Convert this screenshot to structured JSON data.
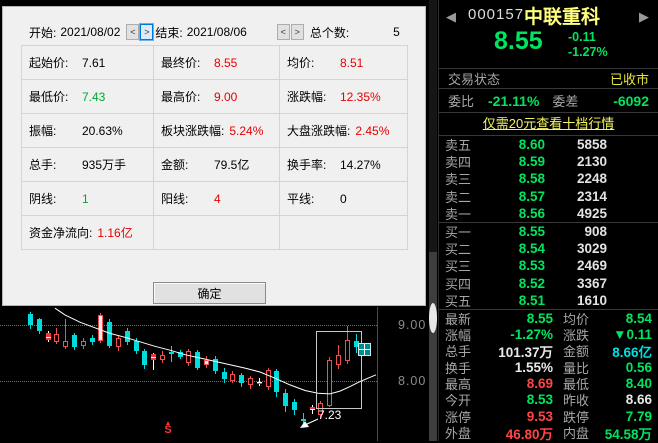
{
  "dialog": {
    "start_label": "开始:",
    "start_value": "2021/08/02",
    "end_label": "结束:",
    "end_value": "2021/08/06",
    "count_label": "总个数:",
    "count_value": "5",
    "spin_prev": "<",
    "spin_next": ">",
    "ok_label": "确定",
    "cells": [
      {
        "label": "起始价:",
        "value": "7.61",
        "color": "black"
      },
      {
        "label": "最终价:",
        "value": "8.55",
        "color": "red"
      },
      {
        "label": "均价:",
        "value": "8.51",
        "color": "red"
      },
      {
        "label": "最低价:",
        "value": "7.43",
        "color": "green"
      },
      {
        "label": "最高价:",
        "value": "9.00",
        "color": "red"
      },
      {
        "label": "涨跌幅:",
        "value": "12.35%",
        "color": "red"
      },
      {
        "label": "振幅:",
        "value": "20.63%",
        "color": "black"
      },
      {
        "label": "板块涨跌幅:",
        "value": "5.24%",
        "color": "red"
      },
      {
        "label": "大盘涨跌幅:",
        "value": "2.45%",
        "color": "red"
      },
      {
        "label": "总手:",
        "value": "935万手",
        "color": "black"
      },
      {
        "label": "金额:",
        "value": "79.5亿",
        "color": "black"
      },
      {
        "label": "换手率:",
        "value": "14.27%",
        "color": "black"
      },
      {
        "label": "阴线:",
        "value": "1",
        "color": "green"
      },
      {
        "label": "阳线:",
        "value": "4",
        "color": "red"
      },
      {
        "label": "平线:",
        "value": "0",
        "color": "black"
      },
      {
        "label": "资金净流向:",
        "value": "1.16亿",
        "color": "red"
      },
      {
        "label": "",
        "value": "",
        "color": "black"
      },
      {
        "label": "",
        "value": "",
        "color": "black"
      }
    ]
  },
  "chart_data": {
    "type": "candlestick",
    "title": "",
    "ylabels": [
      "9.00",
      "8.00"
    ],
    "grid_prices": [
      9.0,
      8.0
    ],
    "ylim": [
      7.0,
      9.32
    ],
    "annotation_low": "7.23",
    "signal_label": "S",
    "candles": [
      [
        9.2,
        9.24,
        8.93,
        9.0,
        ""
      ],
      [
        9.1,
        9.13,
        8.84,
        8.9,
        ""
      ],
      [
        8.74,
        8.9,
        8.7,
        8.86,
        "m"
      ],
      [
        8.7,
        8.94,
        8.66,
        8.84,
        ""
      ],
      [
        8.61,
        9.1,
        8.57,
        8.71,
        ""
      ],
      [
        8.82,
        8.86,
        8.56,
        8.6,
        ""
      ],
      [
        8.62,
        8.77,
        8.58,
        8.71,
        ""
      ],
      [
        8.76,
        8.82,
        8.64,
        8.7,
        ""
      ],
      [
        8.72,
        9.22,
        8.68,
        9.18,
        "w"
      ],
      [
        9.06,
        9.1,
        8.58,
        8.63,
        ""
      ],
      [
        8.6,
        8.83,
        8.55,
        8.77,
        ""
      ],
      [
        8.9,
        8.94,
        8.64,
        8.7,
        ""
      ],
      [
        8.71,
        8.76,
        8.48,
        8.54,
        ""
      ],
      [
        8.54,
        8.58,
        8.22,
        8.28,
        ""
      ],
      [
        8.38,
        8.5,
        8.2,
        8.48,
        "m"
      ],
      [
        8.37,
        8.53,
        8.31,
        8.47,
        ""
      ],
      [
        8.52,
        8.62,
        8.34,
        8.49,
        ""
      ],
      [
        8.51,
        8.55,
        8.39,
        8.43,
        ""
      ],
      [
        8.33,
        8.58,
        8.28,
        8.53,
        ""
      ],
      [
        8.51,
        8.55,
        8.19,
        8.24,
        ""
      ],
      [
        8.28,
        8.44,
        8.23,
        8.38,
        "w"
      ],
      [
        8.4,
        8.45,
        8.12,
        8.18,
        ""
      ],
      [
        8.16,
        8.24,
        7.98,
        8.04,
        ""
      ],
      [
        8.0,
        8.17,
        7.95,
        8.12,
        ""
      ],
      [
        8.1,
        8.15,
        7.9,
        7.97,
        ""
      ],
      [
        7.92,
        8.09,
        7.86,
        8.05,
        ""
      ],
      [
        7.99,
        8.06,
        7.92,
        7.98,
        "m"
      ],
      [
        7.9,
        8.24,
        7.85,
        8.2,
        ""
      ],
      [
        8.18,
        8.22,
        7.72,
        7.8,
        ""
      ],
      [
        7.78,
        7.86,
        7.45,
        7.55,
        ""
      ],
      [
        7.62,
        7.68,
        7.4,
        7.48,
        ""
      ],
      [
        7.32,
        7.42,
        7.23,
        7.3,
        ""
      ],
      [
        7.48,
        7.58,
        7.42,
        7.54,
        "m"
      ],
      [
        7.4,
        7.64,
        7.34,
        7.6,
        ""
      ],
      [
        7.55,
        8.42,
        7.52,
        8.38,
        ""
      ],
      [
        8.28,
        8.64,
        8.22,
        8.46,
        ""
      ],
      [
        8.36,
        8.98,
        8.3,
        8.74,
        ""
      ],
      [
        8.72,
        8.84,
        8.5,
        8.6,
        ""
      ],
      [
        8.62,
        8.68,
        8.44,
        8.55,
        ""
      ]
    ],
    "ma": [
      [
        55,
        9.3
      ],
      [
        65,
        9.18
      ],
      [
        80,
        9.05
      ],
      [
        95,
        8.95
      ],
      [
        110,
        8.85
      ],
      [
        125,
        8.78
      ],
      [
        140,
        8.7
      ],
      [
        155,
        8.62
      ],
      [
        170,
        8.55
      ],
      [
        185,
        8.47
      ],
      [
        200,
        8.41
      ],
      [
        215,
        8.35
      ],
      [
        230,
        8.29
      ],
      [
        245,
        8.23
      ],
      [
        260,
        8.16
      ],
      [
        275,
        8.05
      ],
      [
        290,
        7.93
      ],
      [
        305,
        7.83
      ],
      [
        318,
        7.78
      ],
      [
        330,
        7.77
      ],
      [
        340,
        7.82
      ],
      [
        350,
        7.9
      ],
      [
        360,
        7.99
      ],
      [
        368,
        8.05
      ],
      [
        376,
        8.11
      ]
    ]
  },
  "panel": {
    "nav_prev": "◀",
    "nav_next": "▶",
    "code": "000157",
    "name": "中联重科",
    "price": "8.55",
    "change": "-0.11",
    "change_pct": "-1.27%",
    "status_label": "交易状态",
    "status_value": "已收市",
    "weibi_label": "委比",
    "weibi_value": "-21.11%",
    "weicha_label": "委差",
    "weicha_value": "-6092",
    "link_text": "仅需20元查看十档行情",
    "asks": [
      {
        "label": "卖五",
        "price": "8.60",
        "vol": "5858"
      },
      {
        "label": "卖四",
        "price": "8.59",
        "vol": "2130"
      },
      {
        "label": "卖三",
        "price": "8.58",
        "vol": "2248"
      },
      {
        "label": "卖二",
        "price": "8.57",
        "vol": "2314"
      },
      {
        "label": "卖一",
        "price": "8.56",
        "vol": "4925"
      }
    ],
    "bids": [
      {
        "label": "买一",
        "price": "8.55",
        "vol": "908"
      },
      {
        "label": "买二",
        "price": "8.54",
        "vol": "3029"
      },
      {
        "label": "买三",
        "price": "8.53",
        "vol": "2469"
      },
      {
        "label": "买四",
        "price": "8.52",
        "vol": "3367"
      },
      {
        "label": "买五",
        "price": "8.51",
        "vol": "1610"
      }
    ],
    "stats": [
      {
        "l1": "最新",
        "v1": "8.55",
        "c1": "green",
        "l2": "均价",
        "v2": "8.54",
        "c2": "green"
      },
      {
        "l1": "涨幅",
        "v1": "-1.27%",
        "c1": "green",
        "l2": "涨跌",
        "v2": "▼0.11",
        "c2": "green"
      },
      {
        "l1": "总手",
        "v1": "101.37万",
        "c1": "white",
        "l2": "金额",
        "v2": "8.66亿",
        "c2": "cyan"
      },
      {
        "l1": "换手",
        "v1": "1.55%",
        "c1": "white",
        "l2": "量比",
        "v2": "0.56",
        "c2": "green"
      },
      {
        "l1": "最高",
        "v1": "8.69",
        "c1": "red",
        "l2": "最低",
        "v2": "8.40",
        "c2": "green"
      },
      {
        "l1": "今开",
        "v1": "8.53",
        "c1": "green",
        "l2": "昨收",
        "v2": "8.66",
        "c2": "white"
      },
      {
        "l1": "涨停",
        "v1": "9.53",
        "c1": "red",
        "l2": "跌停",
        "v2": "7.79",
        "c2": "green"
      },
      {
        "l1": "外盘",
        "v1": "46.80万",
        "c1": "red",
        "l2": "内盘",
        "v2": "54.58万",
        "c2": "green"
      }
    ]
  }
}
